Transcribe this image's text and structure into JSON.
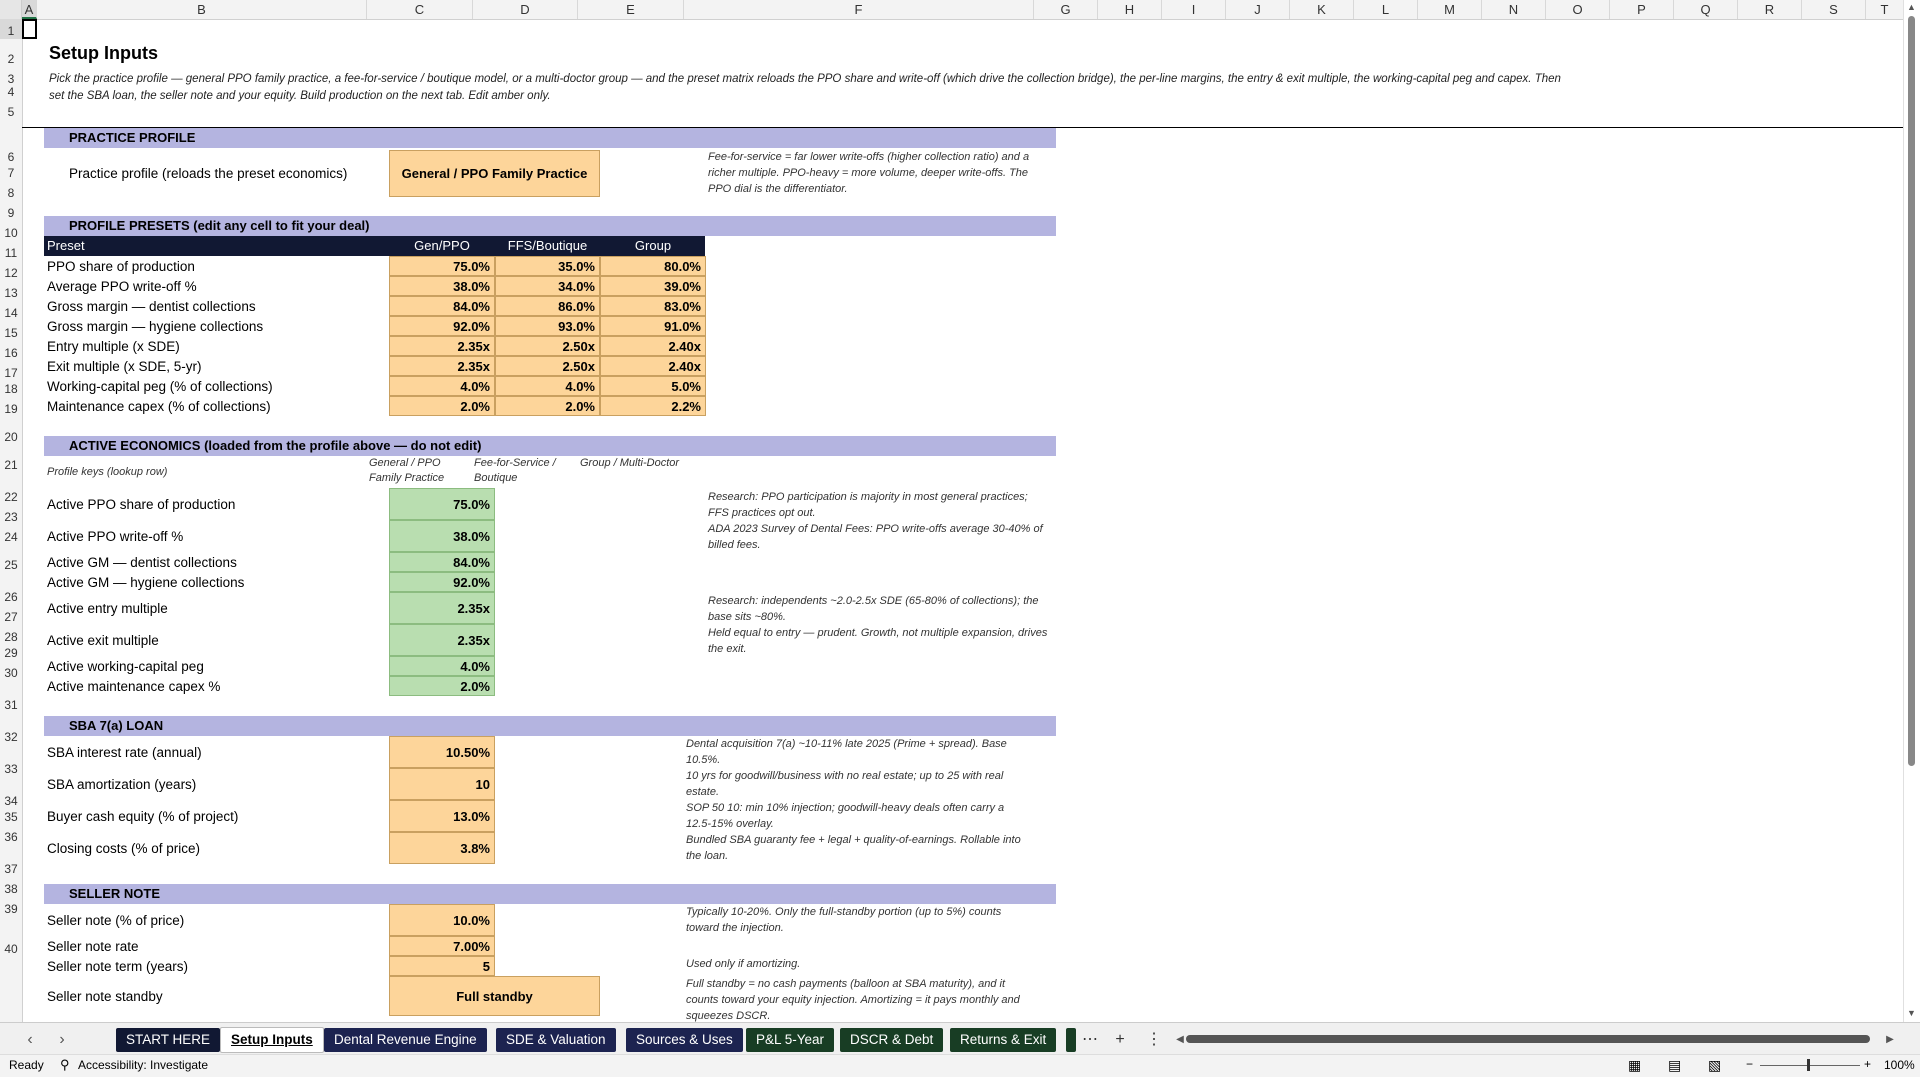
{
  "columns": [
    "A",
    "B",
    "C",
    "D",
    "E",
    "F",
    "G",
    "H",
    "I",
    "J",
    "K",
    "L",
    "M",
    "N",
    "O",
    "P",
    "Q",
    "R",
    "S",
    "T"
  ],
  "rows": [
    "1",
    "2",
    "3",
    "4",
    "5",
    "6",
    "7",
    "8",
    "9",
    "10",
    "11",
    "12",
    "13",
    "14",
    "15",
    "16",
    "17",
    "18",
    "19",
    "20",
    "21",
    "22",
    "23",
    "24",
    "25",
    "26",
    "27",
    "28",
    "29",
    "30",
    "31",
    "32",
    "33",
    "34",
    "35",
    "36",
    "37",
    "38",
    "39",
    "40"
  ],
  "title": "Setup Inputs",
  "intro": "Pick the practice profile — general PPO family practice, a fee-for-service / boutique model, or a multi-doctor group — and the preset matrix reloads the PPO share and write-off (which drive the collection bridge), the per-line margins, the entry & exit multiple, the working-capital peg and capex. Then set the SBA loan, the seller note and your equity. Build production on the next tab. Edit amber only.",
  "practice_profile": {
    "band": "PRACTICE PROFILE",
    "label": "Practice profile (reloads the preset economics)",
    "value": "General / PPO Family Practice",
    "note": "Fee-for-service = far lower write-offs (higher collection ratio) and a richer multiple. PPO-heavy = more volume, deeper write-offs. The PPO dial is the differentiator."
  },
  "presets": {
    "band": "PROFILE PRESETS  (edit any cell to fit your deal)",
    "header": [
      "Preset",
      "Gen/PPO",
      "FFS/Boutique",
      "Group"
    ],
    "rows": [
      {
        "label": "PPO share of production",
        "v": [
          "75.0%",
          "35.0%",
          "80.0%"
        ]
      },
      {
        "label": "Average PPO write-off %",
        "v": [
          "38.0%",
          "34.0%",
          "39.0%"
        ]
      },
      {
        "label": "Gross margin — dentist collections",
        "v": [
          "84.0%",
          "86.0%",
          "83.0%"
        ]
      },
      {
        "label": "Gross margin — hygiene collections",
        "v": [
          "92.0%",
          "93.0%",
          "91.0%"
        ]
      },
      {
        "label": "Entry multiple (x SDE)",
        "v": [
          "2.35x",
          "2.50x",
          "2.40x"
        ]
      },
      {
        "label": "Exit multiple (x SDE, 5-yr)",
        "v": [
          "2.35x",
          "2.50x",
          "2.40x"
        ]
      },
      {
        "label": "Working-capital peg (% of collections)",
        "v": [
          "4.0%",
          "4.0%",
          "5.0%"
        ]
      },
      {
        "label": "Maintenance capex (% of collections)",
        "v": [
          "2.0%",
          "2.0%",
          "2.2%"
        ]
      }
    ]
  },
  "active": {
    "band": "ACTIVE ECONOMICS  (loaded from the profile above — do not edit)",
    "keys_label": "Profile keys (lookup row)",
    "keys": [
      "General / PPO Family Practice",
      "Fee-for-Service / Boutique",
      "Group / Multi-Doctor"
    ],
    "rows": [
      {
        "label": "Active PPO share of production",
        "v": "75.0%"
      },
      {
        "label": "Active PPO write-off %",
        "v": "38.0%"
      },
      {
        "label": "Active GM — dentist collections",
        "v": "84.0%"
      },
      {
        "label": "Active GM — hygiene collections",
        "v": "92.0%"
      },
      {
        "label": "Active entry multiple",
        "v": "2.35x"
      },
      {
        "label": "Active exit multiple",
        "v": "2.35x"
      },
      {
        "label": "Active working-capital peg",
        "v": "4.0%"
      },
      {
        "label": "Active maintenance capex %",
        "v": "2.0%"
      }
    ],
    "notes": [
      "Research: PPO participation is majority in most general practices; FFS practices opt out.",
      "ADA 2023 Survey of Dental Fees: PPO write-offs average 30-40% of billed fees.",
      "Research: independents ~2.0-2.5x SDE (65-80% of collections); the base sits ~80%.",
      "Held equal to entry — prudent. Growth, not multiple expansion, drives the exit."
    ]
  },
  "sba": {
    "band": "SBA 7(a) LOAN",
    "rows": [
      {
        "label": "SBA interest rate (annual)",
        "v": "10.50%",
        "note": "Dental acquisition 7(a) ~10-11% late 2025 (Prime + spread). Base 10.5%."
      },
      {
        "label": "SBA amortization (years)",
        "v": "10",
        "note": "10 yrs for goodwill/business with no real estate; up to 25 with real estate."
      },
      {
        "label": "Buyer cash equity (% of project)",
        "v": "13.0%",
        "note": "SOP 50 10: min 10% injection; goodwill-heavy deals often carry a 12.5-15% overlay."
      },
      {
        "label": "Closing costs (% of price)",
        "v": "3.8%",
        "note": "Bundled SBA guaranty fee + legal + quality-of-earnings. Rollable into the loan."
      }
    ]
  },
  "seller": {
    "band": "SELLER NOTE",
    "rows": [
      {
        "label": "Seller note (% of price)",
        "v": "10.0%",
        "note": "Typically 10-20%. Only the full-standby portion (up to 5%) counts toward the injection."
      },
      {
        "label": "Seller note rate",
        "v": "7.00%",
        "note": ""
      },
      {
        "label": "Seller note term (years)",
        "v": "5",
        "note": "Used only if amortizing."
      },
      {
        "label": "Seller note standby",
        "v": "Full standby",
        "note": "Full standby = no cash payments (balloon at SBA maturity), and it counts toward your equity injection. Amortizing = it pays monthly and squeezes DSCR."
      }
    ]
  },
  "tabs": [
    "START HERE",
    "Setup Inputs",
    "Dental Revenue Engine",
    "SDE & Valuation",
    "Sources & Uses",
    "P&L 5-Year",
    "DSCR & Debt",
    "Returns & Exit"
  ],
  "tab_colors": {
    "start": "#111833",
    "navy": "#1c2350",
    "green": "#183d24"
  },
  "status": {
    "ready": "Ready",
    "accessibility": "Accessibility: Investigate",
    "zoom": "100%"
  }
}
